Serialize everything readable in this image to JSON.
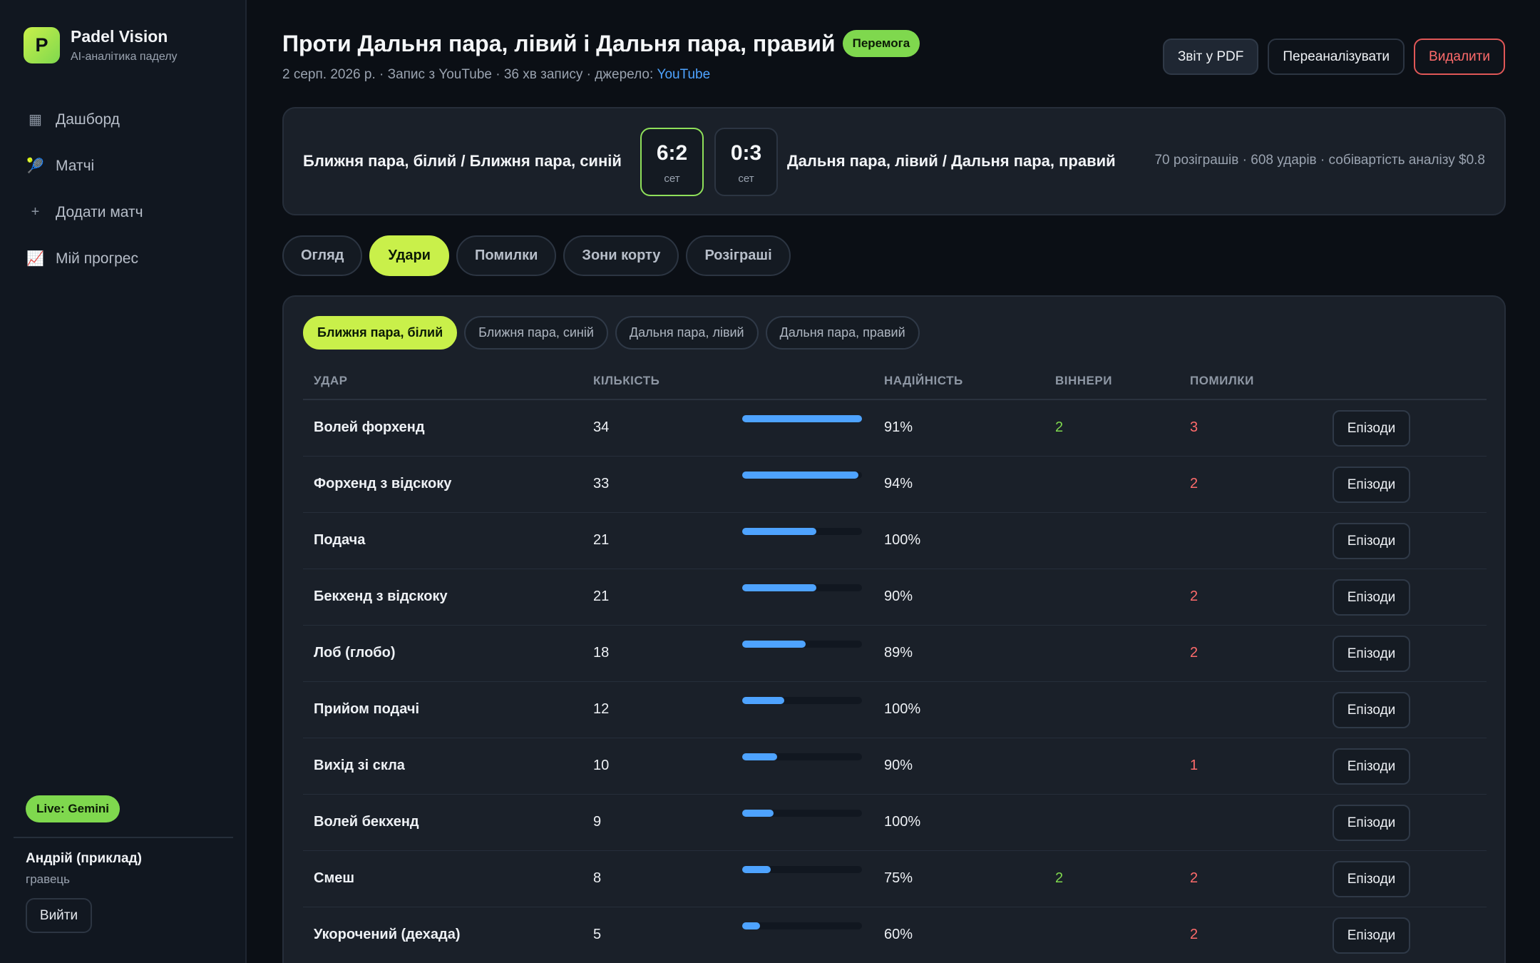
{
  "brand": {
    "logo_letter": "P",
    "title": "Padel Vision",
    "subtitle": "AI-аналітика паделу"
  },
  "nav": [
    {
      "icon": "dashboard-icon",
      "glyph": "▦",
      "label": "Дашборд"
    },
    {
      "icon": "racket-icon",
      "glyph": "🎾",
      "label": "Матчі"
    },
    {
      "icon": "plus-icon",
      "glyph": "+",
      "label": "Додати матч"
    },
    {
      "icon": "chart-icon",
      "glyph": "📈",
      "label": "Мій прогрес"
    }
  ],
  "live_badge": "Live: Gemini",
  "user": {
    "name": "Андрій (приклад)",
    "role": "гравець",
    "logout": "Вийти"
  },
  "header": {
    "title": "Проти Дальня пара, лівий і Дальня пара, правий",
    "result_badge": "Перемога",
    "meta_prefix": "2 серп. 2026 р. · Запис з YouTube · 36 хв запису · джерело: ",
    "meta_link": "YouTube",
    "actions": {
      "pdf": "Звіт у PDF",
      "reanalyze": "Переаналізувати",
      "delete": "Видалити"
    }
  },
  "score": {
    "left_team": "Ближня пара, білий / Ближня пара, синій",
    "right_team": "Дальня пара, лівий / Дальня пара, правий",
    "sets": [
      {
        "score": "6:2",
        "label": "сет",
        "won": true
      },
      {
        "score": "0:3",
        "label": "сет",
        "won": false
      }
    ],
    "stats": "70 розіграшів · 608 ударів · собівартість аналізу $0.8"
  },
  "tabs": [
    "Огляд",
    "Удари",
    "Помилки",
    "Зони корту",
    "Розіграші"
  ],
  "active_tab": 1,
  "player_tabs": [
    "Ближня пара, білий",
    "Ближня пара, синій",
    "Дальня пара, лівий",
    "Дальня пара, правий"
  ],
  "active_player": 0,
  "table": {
    "headers": {
      "stroke": "УДАР",
      "count": "КІЛЬКІСТЬ",
      "reliability": "НАДІЙНІСТЬ",
      "winners": "ВІННЕРИ",
      "errors": "ПОМИЛКИ"
    },
    "episodes_label": "Епізоди",
    "max_count": 34,
    "rows": [
      {
        "name": "Волей форхенд",
        "count": 34,
        "reliability": "91%",
        "winners": "2",
        "errors": "3"
      },
      {
        "name": "Форхенд з відскоку",
        "count": 33,
        "reliability": "94%",
        "winners": "",
        "errors": "2"
      },
      {
        "name": "Подача",
        "count": 21,
        "reliability": "100%",
        "winners": "",
        "errors": ""
      },
      {
        "name": "Бекхенд з відскоку",
        "count": 21,
        "reliability": "90%",
        "winners": "",
        "errors": "2"
      },
      {
        "name": "Лоб (глобо)",
        "count": 18,
        "reliability": "89%",
        "winners": "",
        "errors": "2"
      },
      {
        "name": "Прийом подачі",
        "count": 12,
        "reliability": "100%",
        "winners": "",
        "errors": ""
      },
      {
        "name": "Вихід зі скла",
        "count": 10,
        "reliability": "90%",
        "winners": "",
        "errors": "1"
      },
      {
        "name": "Волей бекхенд",
        "count": 9,
        "reliability": "100%",
        "winners": "",
        "errors": ""
      },
      {
        "name": "Смеш",
        "count": 8,
        "reliability": "75%",
        "winners": "2",
        "errors": "2"
      },
      {
        "name": "Укорочений (дехада)",
        "count": 5,
        "reliability": "60%",
        "winners": "",
        "errors": "2"
      }
    ]
  },
  "colors": {
    "accent": "#c9f04a",
    "success": "#7fd84e",
    "danger": "#ff6b6b",
    "link": "#4ea3ff",
    "bar": "#4ea3ff"
  }
}
